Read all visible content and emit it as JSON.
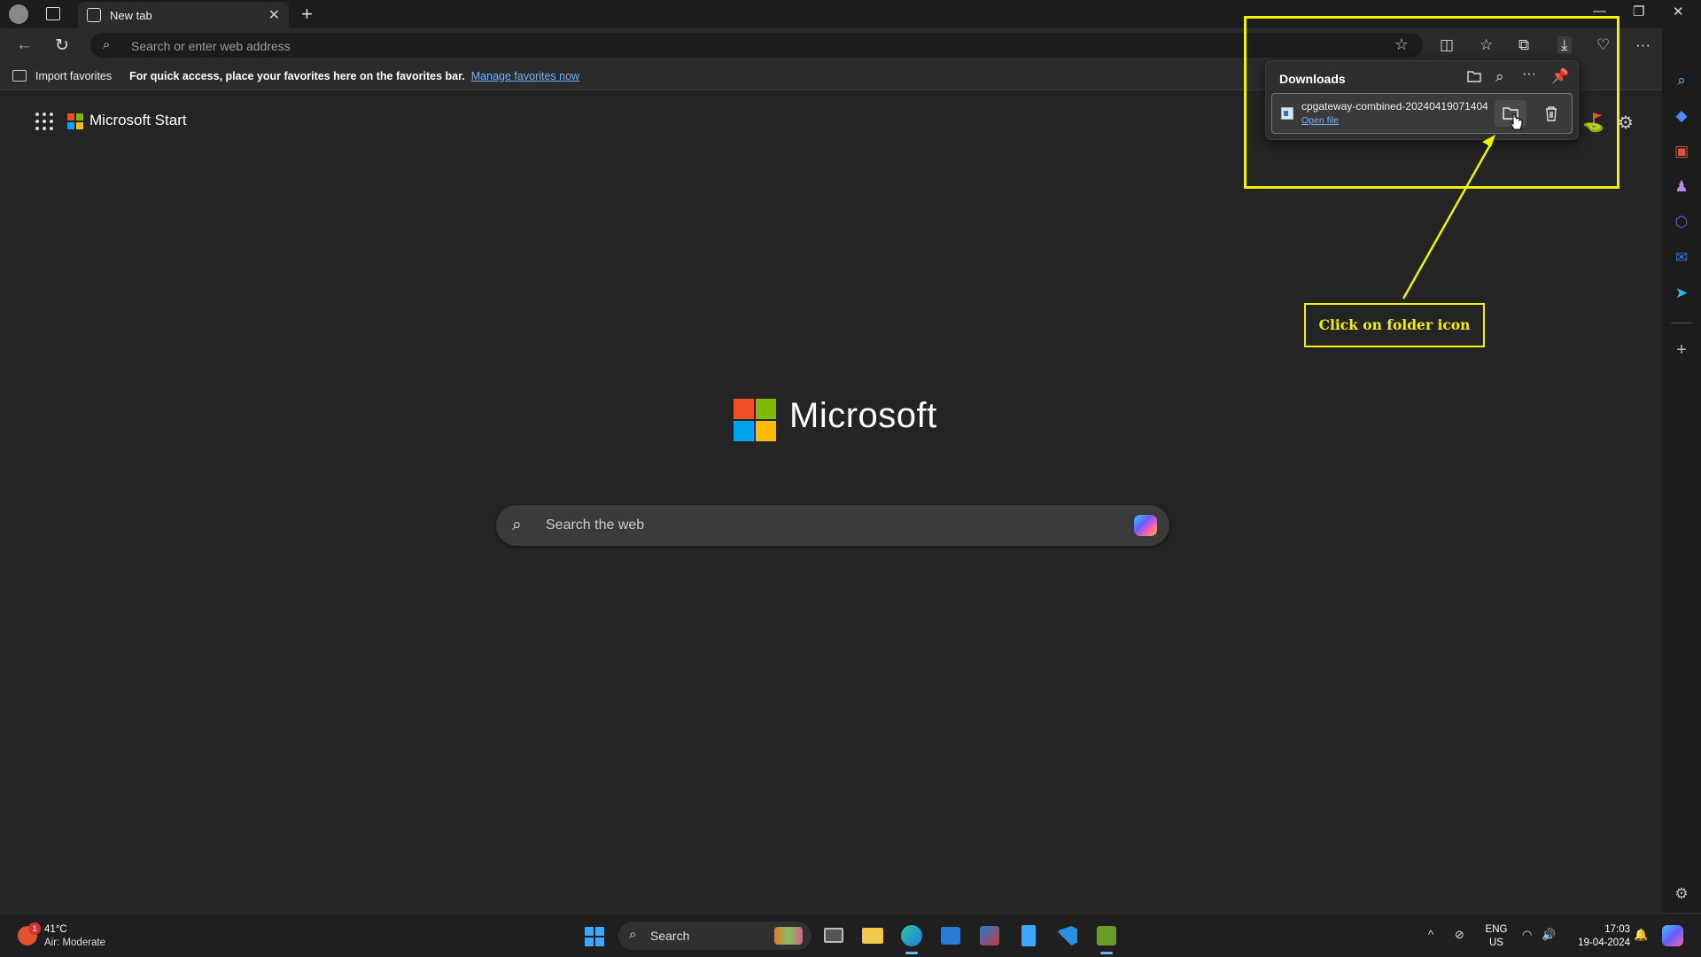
{
  "browser": {
    "tab_title": "New tab",
    "address_placeholder": "Search or enter web address"
  },
  "favorites_bar": {
    "import_label": "Import favorites",
    "hint": "For quick access, place your favorites here on the favorites bar.",
    "manage_link": "Manage favorites now"
  },
  "page": {
    "brand_label": "Microsoft Start",
    "logo_word": "Microsoft",
    "search_placeholder": "Search the web"
  },
  "downloads": {
    "title": "Downloads",
    "item": {
      "filename": "cpgateway-combined-20240419071404",
      "action_link": "Open file"
    }
  },
  "annotation": {
    "callout": "Click on folder icon"
  },
  "taskbar": {
    "weather_badge": "1",
    "temperature": "41°C",
    "air_quality": "Air: Moderate",
    "search_placeholder": "Search",
    "language_top": "ENG",
    "language_bottom": "US",
    "time": "17:03",
    "date": "19-04-2024"
  },
  "colors": {
    "annotation": "#f2f200",
    "link": "#6cb4ff",
    "ms_red": "#f25022",
    "ms_green": "#7fba00",
    "ms_blue": "#00a4ef",
    "ms_yellow": "#ffb900"
  }
}
